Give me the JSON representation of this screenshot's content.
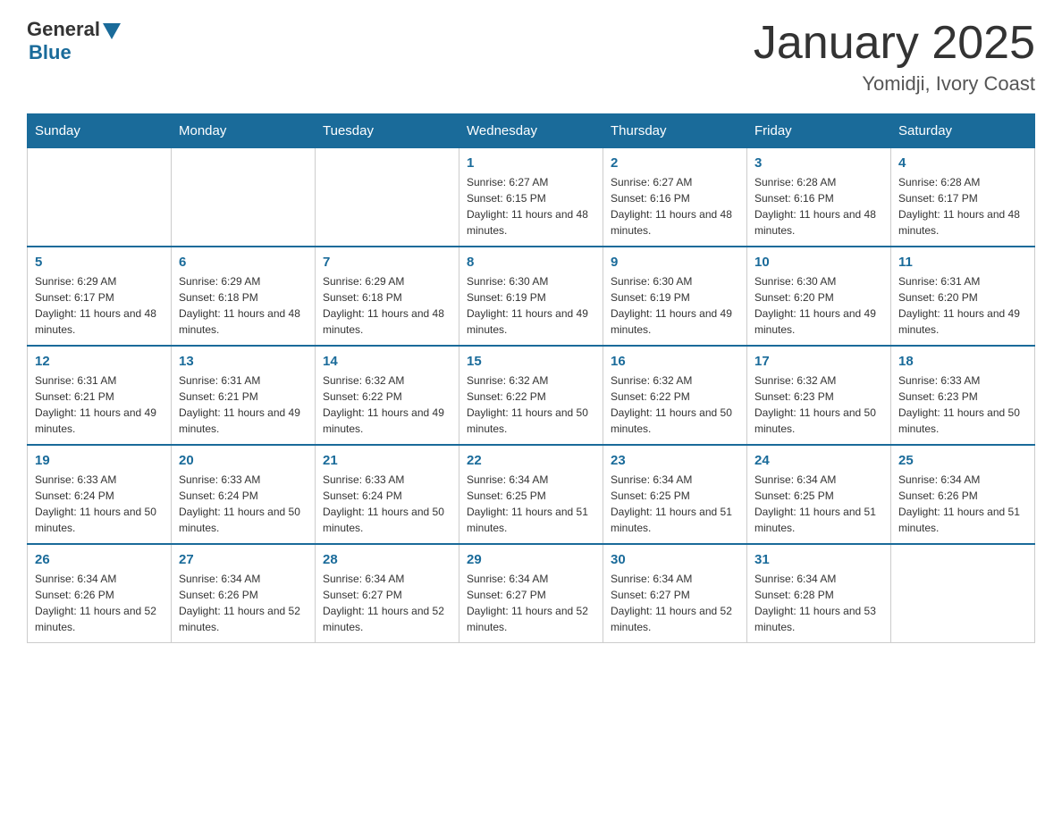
{
  "header": {
    "logo_general": "General",
    "logo_blue": "Blue",
    "month_title": "January 2025",
    "location": "Yomidji, Ivory Coast"
  },
  "days_of_week": [
    "Sunday",
    "Monday",
    "Tuesday",
    "Wednesday",
    "Thursday",
    "Friday",
    "Saturday"
  ],
  "weeks": [
    [
      {
        "day": "",
        "info": ""
      },
      {
        "day": "",
        "info": ""
      },
      {
        "day": "",
        "info": ""
      },
      {
        "day": "1",
        "info": "Sunrise: 6:27 AM\nSunset: 6:15 PM\nDaylight: 11 hours and 48 minutes."
      },
      {
        "day": "2",
        "info": "Sunrise: 6:27 AM\nSunset: 6:16 PM\nDaylight: 11 hours and 48 minutes."
      },
      {
        "day": "3",
        "info": "Sunrise: 6:28 AM\nSunset: 6:16 PM\nDaylight: 11 hours and 48 minutes."
      },
      {
        "day": "4",
        "info": "Sunrise: 6:28 AM\nSunset: 6:17 PM\nDaylight: 11 hours and 48 minutes."
      }
    ],
    [
      {
        "day": "5",
        "info": "Sunrise: 6:29 AM\nSunset: 6:17 PM\nDaylight: 11 hours and 48 minutes."
      },
      {
        "day": "6",
        "info": "Sunrise: 6:29 AM\nSunset: 6:18 PM\nDaylight: 11 hours and 48 minutes."
      },
      {
        "day": "7",
        "info": "Sunrise: 6:29 AM\nSunset: 6:18 PM\nDaylight: 11 hours and 48 minutes."
      },
      {
        "day": "8",
        "info": "Sunrise: 6:30 AM\nSunset: 6:19 PM\nDaylight: 11 hours and 49 minutes."
      },
      {
        "day": "9",
        "info": "Sunrise: 6:30 AM\nSunset: 6:19 PM\nDaylight: 11 hours and 49 minutes."
      },
      {
        "day": "10",
        "info": "Sunrise: 6:30 AM\nSunset: 6:20 PM\nDaylight: 11 hours and 49 minutes."
      },
      {
        "day": "11",
        "info": "Sunrise: 6:31 AM\nSunset: 6:20 PM\nDaylight: 11 hours and 49 minutes."
      }
    ],
    [
      {
        "day": "12",
        "info": "Sunrise: 6:31 AM\nSunset: 6:21 PM\nDaylight: 11 hours and 49 minutes."
      },
      {
        "day": "13",
        "info": "Sunrise: 6:31 AM\nSunset: 6:21 PM\nDaylight: 11 hours and 49 minutes."
      },
      {
        "day": "14",
        "info": "Sunrise: 6:32 AM\nSunset: 6:22 PM\nDaylight: 11 hours and 49 minutes."
      },
      {
        "day": "15",
        "info": "Sunrise: 6:32 AM\nSunset: 6:22 PM\nDaylight: 11 hours and 50 minutes."
      },
      {
        "day": "16",
        "info": "Sunrise: 6:32 AM\nSunset: 6:22 PM\nDaylight: 11 hours and 50 minutes."
      },
      {
        "day": "17",
        "info": "Sunrise: 6:32 AM\nSunset: 6:23 PM\nDaylight: 11 hours and 50 minutes."
      },
      {
        "day": "18",
        "info": "Sunrise: 6:33 AM\nSunset: 6:23 PM\nDaylight: 11 hours and 50 minutes."
      }
    ],
    [
      {
        "day": "19",
        "info": "Sunrise: 6:33 AM\nSunset: 6:24 PM\nDaylight: 11 hours and 50 minutes."
      },
      {
        "day": "20",
        "info": "Sunrise: 6:33 AM\nSunset: 6:24 PM\nDaylight: 11 hours and 50 minutes."
      },
      {
        "day": "21",
        "info": "Sunrise: 6:33 AM\nSunset: 6:24 PM\nDaylight: 11 hours and 50 minutes."
      },
      {
        "day": "22",
        "info": "Sunrise: 6:34 AM\nSunset: 6:25 PM\nDaylight: 11 hours and 51 minutes."
      },
      {
        "day": "23",
        "info": "Sunrise: 6:34 AM\nSunset: 6:25 PM\nDaylight: 11 hours and 51 minutes."
      },
      {
        "day": "24",
        "info": "Sunrise: 6:34 AM\nSunset: 6:25 PM\nDaylight: 11 hours and 51 minutes."
      },
      {
        "day": "25",
        "info": "Sunrise: 6:34 AM\nSunset: 6:26 PM\nDaylight: 11 hours and 51 minutes."
      }
    ],
    [
      {
        "day": "26",
        "info": "Sunrise: 6:34 AM\nSunset: 6:26 PM\nDaylight: 11 hours and 52 minutes."
      },
      {
        "day": "27",
        "info": "Sunrise: 6:34 AM\nSunset: 6:26 PM\nDaylight: 11 hours and 52 minutes."
      },
      {
        "day": "28",
        "info": "Sunrise: 6:34 AM\nSunset: 6:27 PM\nDaylight: 11 hours and 52 minutes."
      },
      {
        "day": "29",
        "info": "Sunrise: 6:34 AM\nSunset: 6:27 PM\nDaylight: 11 hours and 52 minutes."
      },
      {
        "day": "30",
        "info": "Sunrise: 6:34 AM\nSunset: 6:27 PM\nDaylight: 11 hours and 52 minutes."
      },
      {
        "day": "31",
        "info": "Sunrise: 6:34 AM\nSunset: 6:28 PM\nDaylight: 11 hours and 53 minutes."
      },
      {
        "day": "",
        "info": ""
      }
    ]
  ]
}
